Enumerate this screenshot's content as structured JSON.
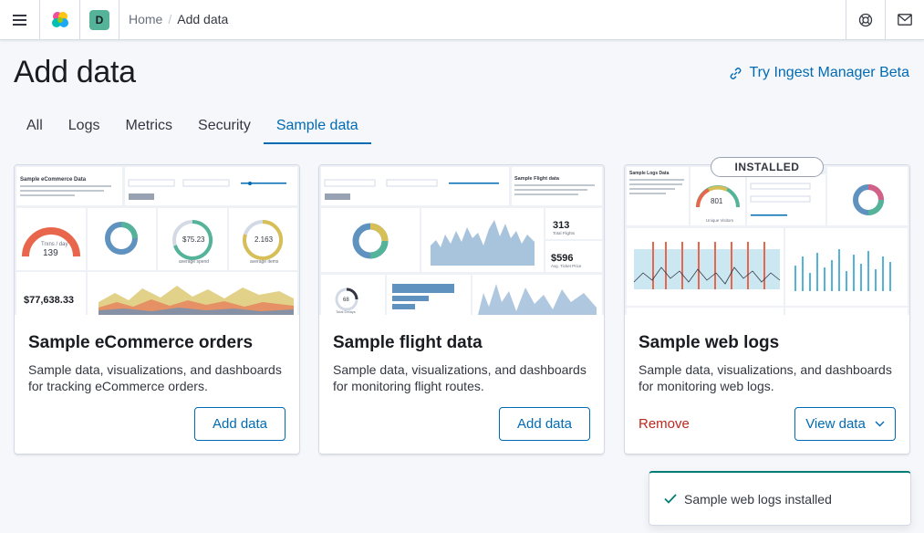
{
  "header": {
    "space_initial": "D",
    "breadcrumbs": {
      "home": "Home",
      "separator": "/",
      "current": "Add data"
    },
    "icons": [
      "menu-icon",
      "elastic-logo",
      "help-icon",
      "mail-icon"
    ]
  },
  "page": {
    "title": "Add data",
    "ingest_link": "Try Ingest Manager Beta"
  },
  "tabs": [
    {
      "label": "All",
      "active": false
    },
    {
      "label": "Logs",
      "active": false
    },
    {
      "label": "Metrics",
      "active": false
    },
    {
      "label": "Security",
      "active": false
    },
    {
      "label": "Sample data",
      "active": true
    }
  ],
  "cards": [
    {
      "title": "Sample eCommerce orders",
      "description": "Sample data, visualizations, and dashboards for tracking eCommerce orders.",
      "button": "Add data",
      "preview": {
        "header": "Sample eCommerce Data",
        "stat_label": "Trxns / day",
        "stat_value": "139",
        "metric_1": "$75.23",
        "metric_1_label": "average spend",
        "metric_2": "2.163",
        "metric_2_label": "average items",
        "revenue": "$77,638.33"
      }
    },
    {
      "title": "Sample flight data",
      "description": "Sample data, visualizations, and dashboards for monitoring flight routes.",
      "button": "Add data",
      "preview": {
        "header": "Sample Flight data",
        "total_flights": "313",
        "total_flights_label": "Total Flights",
        "avg_price": "$596",
        "avg_price_label": "Avg. Ticket Price",
        "delays": "68",
        "delays_label": "Total Delays"
      }
    },
    {
      "title": "Sample web logs",
      "description": "Sample data, visualizations, and dashboards for monitoring web logs.",
      "badge": "INSTALLED",
      "remove": "Remove",
      "button": "View data",
      "preview": {
        "header": "Sample Logs Data",
        "gauge_value": "801",
        "gauge_label": "Unique Visitors"
      }
    }
  ],
  "toast": {
    "text": "Sample web logs installed"
  },
  "colors": {
    "accent": "#006bb4",
    "danger": "#bd271e",
    "success": "#017d73"
  }
}
